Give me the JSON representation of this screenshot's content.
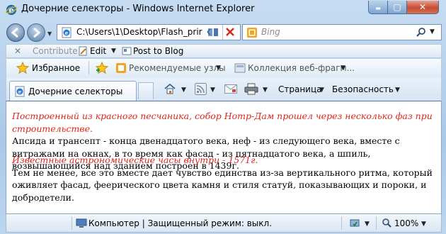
{
  "window": {
    "title": "Дочерние селекторы - Windows Internet Explorer",
    "min_glyph": "▬",
    "max_glyph": "▢",
    "close_glyph": "✕"
  },
  "address": {
    "url": "C:\\Users\\1\\Desktop\\Flash_prir"
  },
  "search": {
    "placeholder": "Bing"
  },
  "command_bar": {
    "close_glyph": "✕",
    "contribute": "Contribute",
    "edit": "Edit",
    "post": "Post to Blog"
  },
  "favorites": {
    "favorites_label": "Избранное",
    "suggested": "Рекомендуемые узлы",
    "web_slices": "Коллекция веб-фрагм...",
    "dropdown_glyph": "▼"
  },
  "tab": {
    "label": "Дочерние селекторы"
  },
  "toolbar": {
    "page": "Страница",
    "safety": "Безопасность"
  },
  "content": {
    "paragraph1_red": "Построенный из красного песчаника, собор Нотр-Дам прошел через несколько фаз при строительстве.",
    "paragraph1_text": "Апсида и трансепт - конца двенадцатого века, неф - из следующего века, вместе с витражами на окнах, в то время как фасад - из пятнадцатого века, а шпиль, возвышающийся над зданием построен в 1439г.",
    "paragraph2_red": "Известные астрономические часы внутри - 1571г.",
    "paragraph2_text": "Тем не менее, все это вместе дает чувство единства из-за вертикального ритма, который оживляет фасад, феерического цвета камня и стиля статуй, показывающих и пороки, и добродетели."
  },
  "status": {
    "zone": "Компьютер | Защищенный режим: выкл.",
    "zoom": "100%"
  },
  "colors": {
    "accent_red": "#e0241b",
    "frame": "#a9c8e8"
  }
}
